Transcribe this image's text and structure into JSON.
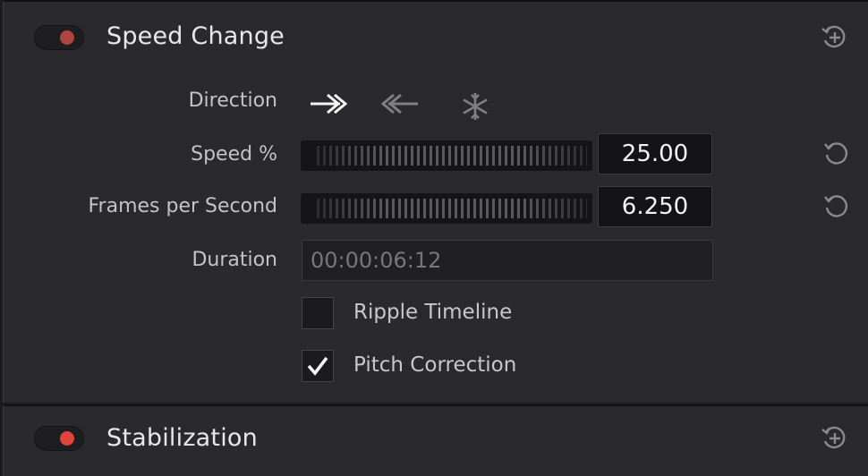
{
  "speed_change": {
    "title": "Speed Change",
    "enabled_color": "#b0453f",
    "reset_icon": "add-keyframe-icon",
    "direction": {
      "label": "Direction",
      "options": [
        "forward-icon",
        "reverse-icon",
        "freeze-icon"
      ],
      "selected": "forward"
    },
    "speed": {
      "label": "Speed %",
      "value": "25.00",
      "reset_icon": "reset-icon"
    },
    "fps": {
      "label": "Frames per Second",
      "value": "6.250",
      "reset_icon": "reset-icon"
    },
    "duration": {
      "label": "Duration",
      "value": "00:00:06:12"
    },
    "ripple_timeline": {
      "label": "Ripple Timeline",
      "checked": false
    },
    "pitch_correction": {
      "label": "Pitch Correction",
      "checked": true
    }
  },
  "stabilization": {
    "title": "Stabilization",
    "enabled_color": "#e0443c",
    "reset_icon": "add-keyframe-icon"
  }
}
